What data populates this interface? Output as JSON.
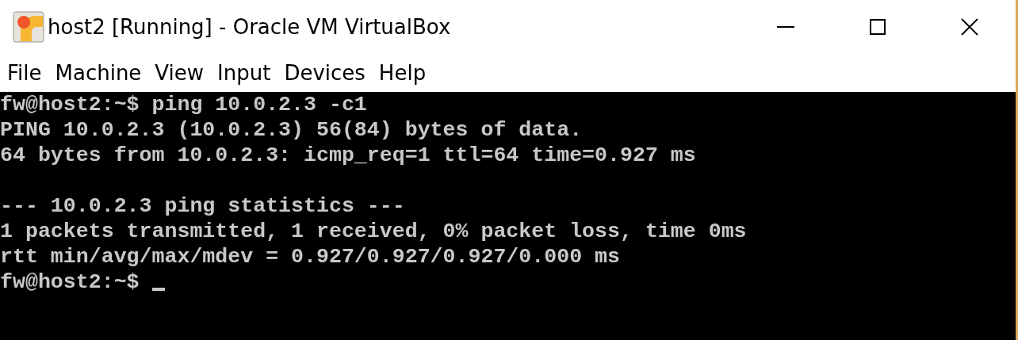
{
  "window": {
    "title": "host2 [Running] - Oracle VM VirtualBox"
  },
  "menu": [
    "File",
    "Machine",
    "View",
    "Input",
    "Devices",
    "Help"
  ],
  "terminal": {
    "blocks": [
      [
        "fw@host2:~$ ping 10.0.2.3 -c1",
        "PING 10.0.2.3 (10.0.2.3) 56(84) bytes of data.",
        "64 bytes from 10.0.2.3: icmp_req=1 ttl=64 time=0.927 ms"
      ],
      [
        "--- 10.0.2.3 ping statistics ---",
        "1 packets transmitted, 1 received, 0% packet loss, time 0ms",
        "rtt min/avg/max/mdev = 0.927/0.927/0.927/0.000 ms",
        "fw@host2:~$"
      ]
    ],
    "cursor": true
  }
}
